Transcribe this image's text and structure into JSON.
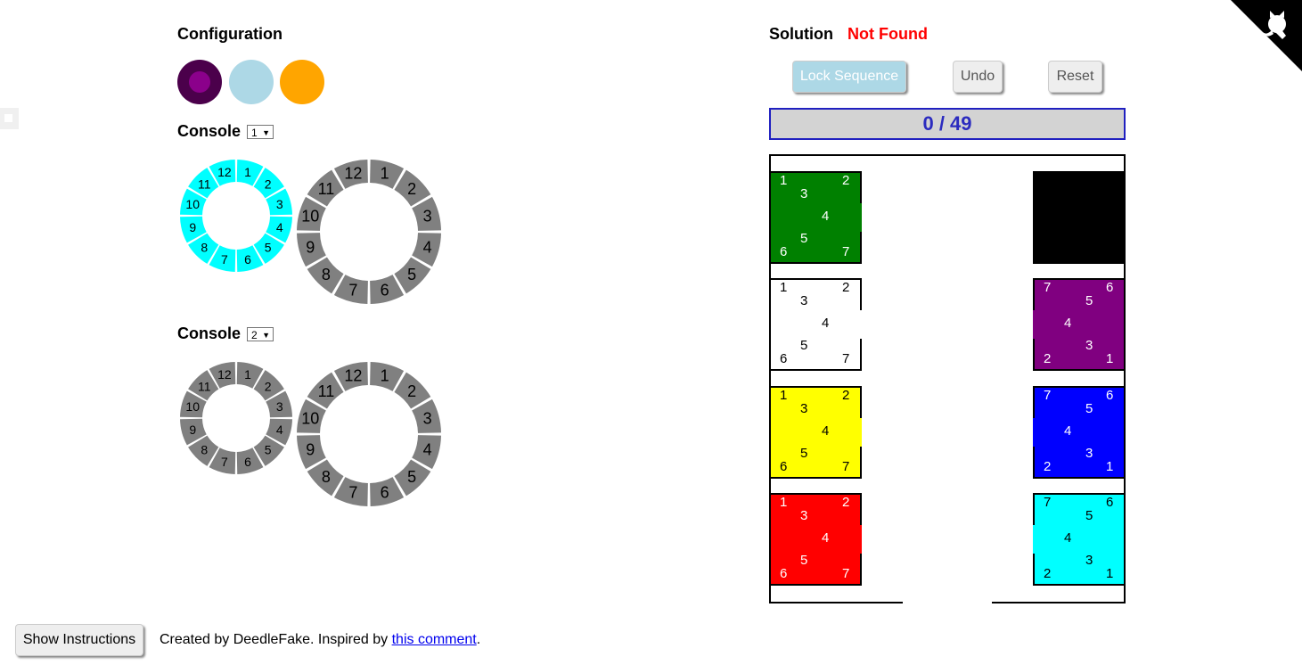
{
  "configuration": {
    "title": "Configuration",
    "swatches": [
      {
        "name": "swatch-purple",
        "color": "#4b004b",
        "inner": "#8b008b"
      },
      {
        "name": "swatch-lightblue",
        "color": "#add8e6"
      },
      {
        "name": "swatch-orange",
        "color": "#ffa500"
      }
    ]
  },
  "consoles": [
    {
      "label": "Console",
      "selected": "1",
      "small_ring_color": "#00ffff"
    },
    {
      "label": "Console",
      "selected": "2",
      "small_ring_color": "#808080"
    }
  ],
  "ring_numbers": [
    "1",
    "2",
    "3",
    "4",
    "5",
    "6",
    "7",
    "8",
    "9",
    "10",
    "11",
    "12"
  ],
  "solution": {
    "label": "Solution",
    "status": "Not Found",
    "status_color": "#ff0000"
  },
  "buttons": {
    "lock": "Lock Sequence",
    "undo": "Undo",
    "reset": "Reset"
  },
  "counter": "0 / 49",
  "pins": [
    "1",
    "2",
    "3",
    "4",
    "5",
    "6",
    "7"
  ],
  "left_cells": [
    {
      "color": "#008000",
      "text_color": "#ffffff"
    },
    {
      "color": "#ffffff",
      "text_color": "#000000"
    },
    {
      "color": "#ffff00",
      "text_color": "#000000"
    },
    {
      "color": "#ff0000",
      "text_color": "#ffffff"
    }
  ],
  "right_cells": [
    {
      "color": "#000000",
      "text_color": "#000000",
      "numbers_visible": false
    },
    {
      "color": "#800080",
      "text_color": "#ffffff",
      "numbers_visible": true
    },
    {
      "color": "#0000ff",
      "text_color": "#ffffff",
      "numbers_visible": true
    },
    {
      "color": "#00ffff",
      "text_color": "#000000",
      "numbers_visible": true
    }
  ],
  "footer": {
    "show_instructions": "Show Instructions",
    "credit": "Created by DeedleFake. Inspired by ",
    "link": "this comment",
    "period": "."
  },
  "corner_icon": "github-cat-icon"
}
